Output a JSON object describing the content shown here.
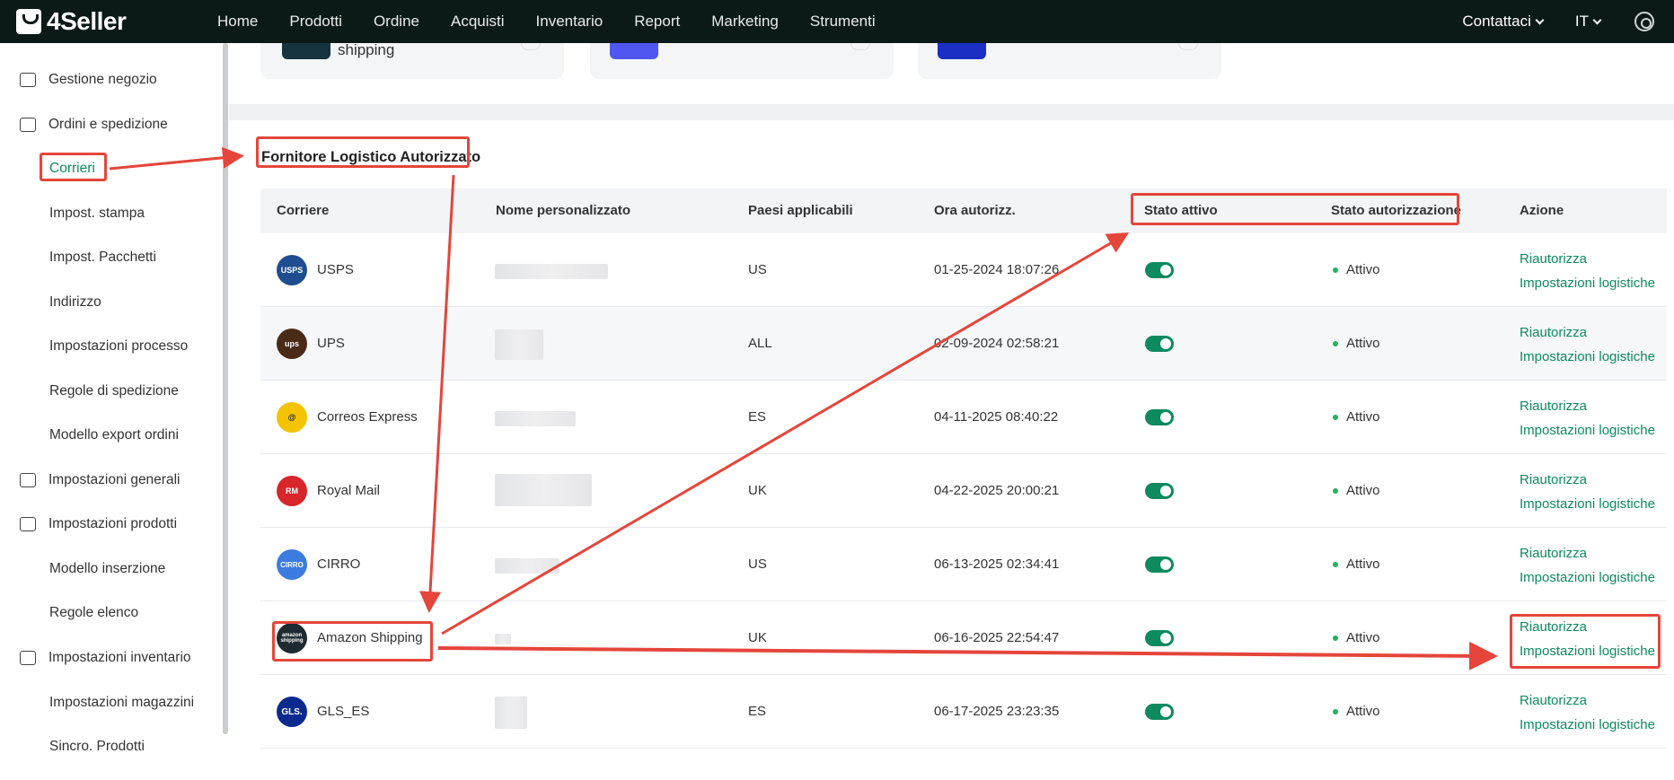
{
  "brand": {
    "name": "4Seller"
  },
  "nav": [
    "Home",
    "Prodotti",
    "Ordine",
    "Acquisti",
    "Inventario",
    "Report",
    "Marketing",
    "Strumenti"
  ],
  "topright": {
    "contact": "Contattaci",
    "lang": "IT"
  },
  "sidebar": {
    "items": [
      {
        "label": "Gestione negozio",
        "type": "group"
      },
      {
        "label": "Ordini e spedizione",
        "type": "group"
      },
      {
        "label": "Corrieri",
        "type": "sub",
        "active": true
      },
      {
        "label": "Impost. stampa",
        "type": "sub"
      },
      {
        "label": "Impost. Pacchetti",
        "type": "sub"
      },
      {
        "label": "Indirizzo",
        "type": "sub"
      },
      {
        "label": "Impostazioni processo",
        "type": "sub"
      },
      {
        "label": "Regole di spedizione",
        "type": "sub"
      },
      {
        "label": "Modello export ordini",
        "type": "sub"
      },
      {
        "label": "Impostazioni generali",
        "type": "group"
      },
      {
        "label": "Impostazioni prodotti",
        "type": "group"
      },
      {
        "label": "Modello inserzione",
        "type": "sub"
      },
      {
        "label": "Regole elenco",
        "type": "sub"
      },
      {
        "label": "Impostazioni inventario",
        "type": "group"
      },
      {
        "label": "Impostazioni magazzini",
        "type": "sub"
      },
      {
        "label": "Sincro. Prodotti",
        "type": "sub"
      }
    ]
  },
  "top_cards": {
    "partial_text": "shipping"
  },
  "section": {
    "title": "Fornitore Logistico Autorizzato",
    "columns": [
      "Corriere",
      "Nome personalizzato",
      "Paesi applicabili",
      "Ora autorizz.",
      "Stato attivo",
      "Stato autorizzazione",
      "Azione"
    ],
    "rows": [
      {
        "carrier": "USPS",
        "country": "US",
        "time": "01-25-2024 18:07:26",
        "status": "Attivo",
        "logo_color": "#1f4d8f",
        "logo_text": "USPS"
      },
      {
        "carrier": "UPS",
        "country": "ALL",
        "time": "02-09-2024 02:58:21",
        "status": "Attivo",
        "logo_color": "#4a2b17",
        "logo_text": "ups"
      },
      {
        "carrier": "Correos Express",
        "country": "ES",
        "time": "04-11-2025 08:40:22",
        "status": "Attivo",
        "logo_color": "#f4c400",
        "logo_text": "@"
      },
      {
        "carrier": "Royal Mail",
        "country": "UK",
        "time": "04-22-2025 20:00:21",
        "status": "Attivo",
        "logo_color": "#d8262a",
        "logo_text": "RM"
      },
      {
        "carrier": "CIRRO",
        "country": "US",
        "time": "06-13-2025 02:34:41",
        "status": "Attivo",
        "logo_color": "#3c7be0",
        "logo_text": "CIRRO"
      },
      {
        "carrier": "Amazon Shipping",
        "country": "UK",
        "time": "06-16-2025 22:54:47",
        "status": "Attivo",
        "logo_color": "#1d2a2f",
        "logo_text": "amazon shipping"
      },
      {
        "carrier": "GLS_ES",
        "country": "ES",
        "time": "06-17-2025 23:23:35",
        "status": "Attivo",
        "logo_color": "#0b2a8f",
        "logo_text": "GLS."
      }
    ],
    "actions": {
      "reauth": "Riautorizza",
      "settings": "Impostazioni logistiche"
    }
  },
  "colors": {
    "accent": "#0e8a5f",
    "annotation": "#e5453b",
    "topbar": "#0c1a17"
  }
}
